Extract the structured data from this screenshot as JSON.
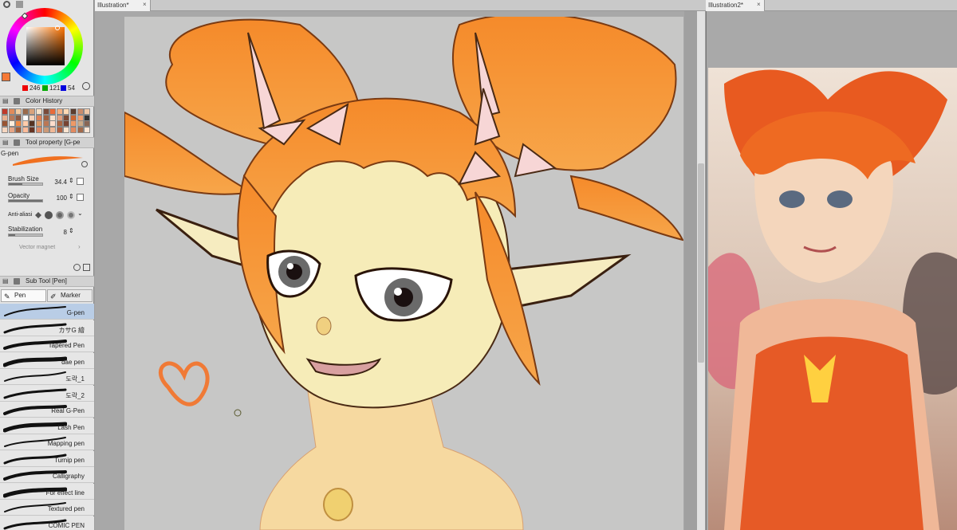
{
  "tabs": {
    "main": "Illustration*",
    "second": "Illustration2*"
  },
  "color": {
    "r": "246",
    "g": "121",
    "b": "54",
    "main_hex": "#f67936"
  },
  "panels": {
    "color_history": "Color History",
    "tool_property": "Tool property [G-pe",
    "sub_tool": "Sub Tool [Pen]"
  },
  "tool": {
    "name": "G-pen",
    "brush_size_label": "Brush Size",
    "brush_size": "34.4",
    "opacity_label": "Opacity",
    "opacity": "100",
    "antialias_label": "Anti-aliasi",
    "stabilization_label": "Stabilization",
    "stabilization": "8",
    "vector_magnet_label": "Vector magnet"
  },
  "subtool_tabs": {
    "pen": "Pen",
    "marker": "Marker"
  },
  "brushes": [
    {
      "name": "G-pen"
    },
    {
      "name": "カサG 繪"
    },
    {
      "name": "Tapered Pen"
    },
    {
      "name": "dae pen"
    },
    {
      "name": "도락_1"
    },
    {
      "name": "도락_2"
    },
    {
      "name": "Real G-Pen"
    },
    {
      "name": "Lash Pen"
    },
    {
      "name": "Mapping pen"
    },
    {
      "name": "Turnip pen"
    },
    {
      "name": "Calligraphy"
    },
    {
      "name": "For effect line"
    },
    {
      "name": "Textured pen"
    },
    {
      "name": "COMIC PEN"
    }
  ],
  "history_colors": [
    "#c0392b",
    "#e08a5a",
    "#f2c9a0",
    "#9b6a4b",
    "#d9a27a",
    "#f5e2c8",
    "#7a4b3a",
    "#e86b3a",
    "#f4b183",
    "#ffd9b3",
    "#5c3d2e",
    "#c98b6b",
    "#f0c8a8",
    "#e9b090",
    "#b7795a",
    "#8c5a44",
    "#ffffff",
    "#f7d0b5",
    "#dd7f55",
    "#a0603f",
    "#f8e0cc",
    "#e0a080",
    "#7d4a35",
    "#cc6633",
    "#f1a070",
    "#333333",
    "#995533",
    "#ffeedd",
    "#ee8844",
    "#ffccaa",
    "#553322",
    "#dd9966",
    "#bb7755",
    "#ffddcc",
    "#aa6644",
    "#774433",
    "#ee9966",
    "#ccaa88",
    "#886655",
    "#f6d6c0",
    "#e6a585",
    "#9a5c3c",
    "#ffbb99",
    "#663322",
    "#dd8866",
    "#cc9977",
    "#f0b896",
    "#b06040",
    "#fce4d0",
    "#e28a60",
    "#a36a4a",
    "#ffe6d6"
  ],
  "status_swatches": [
    "#ff0000",
    "#00aa00",
    "#0000ff"
  ]
}
